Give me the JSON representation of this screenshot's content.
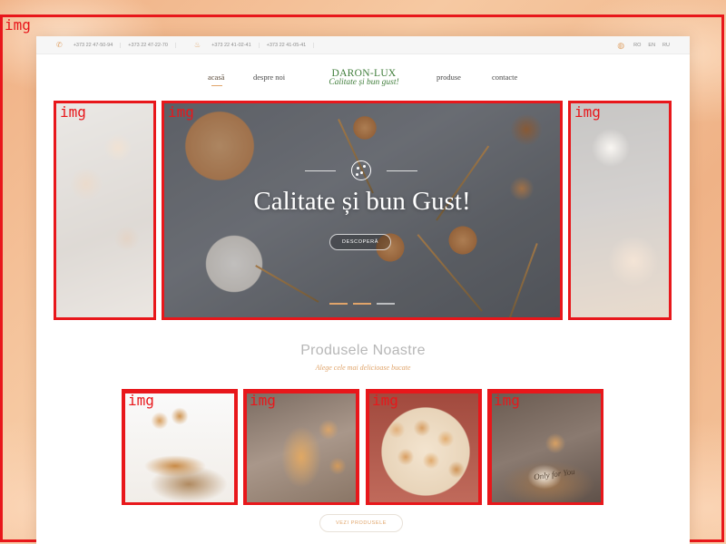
{
  "topbar": {
    "phones": [
      "+373 22 47-50-94",
      "+373 22 47-22-70",
      "+373 22 41-02-41",
      "+373 22 41-05-41"
    ],
    "languages": [
      "RO",
      "EN",
      "RU"
    ]
  },
  "nav": {
    "items": [
      "acasă",
      "despre noi",
      "produse",
      "contacte"
    ],
    "active": "acasă"
  },
  "logo": {
    "title": "DARON-LUX",
    "tagline": "Calitate și bun gust!"
  },
  "hero": {
    "title": "Calitate și bun Gust!",
    "button": "DESCOPERĂ",
    "slides": 3,
    "active_slide": 2
  },
  "products": {
    "title": "Produsele Noastre",
    "subtitle": "Alege cele mai delicioase bucate",
    "card4_tag": "Only for You",
    "button": "VEZI PRODUSELE"
  },
  "detection_label": "img",
  "colors": {
    "accent": "#e0a46a",
    "logo_green": "#3f7d3a",
    "box_red": "#e8171b"
  }
}
